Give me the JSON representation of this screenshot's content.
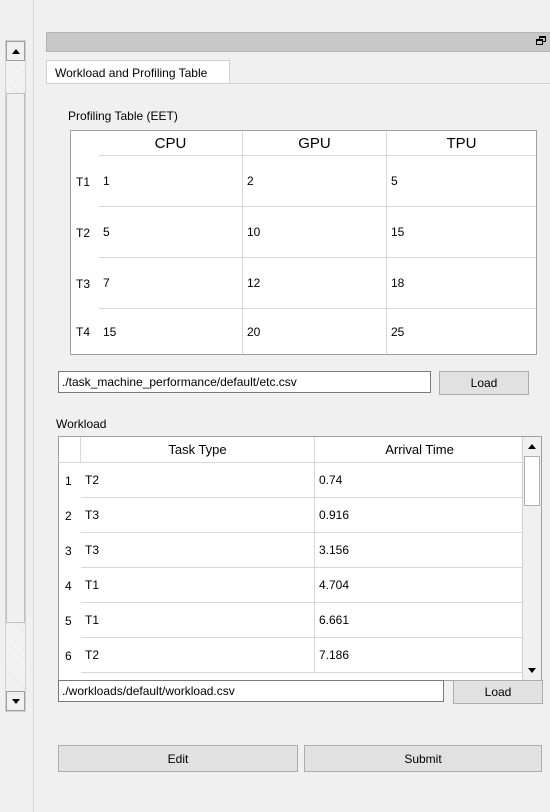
{
  "tab": {
    "label": "Workload and Profiling Table"
  },
  "profiling": {
    "section_label": "Profiling Table (EET)",
    "columns": [
      "CPU",
      "GPU",
      "TPU"
    ],
    "rows": [
      {
        "label": "T1",
        "values": [
          "1",
          "2",
          "5"
        ]
      },
      {
        "label": "T2",
        "values": [
          "5",
          "10",
          "15"
        ]
      },
      {
        "label": "T3",
        "values": [
          "7",
          "12",
          "18"
        ]
      },
      {
        "label": "T4",
        "values": [
          "15",
          "20",
          "25"
        ]
      }
    ],
    "path_value": "./task_machine_performance/default/etc.csv",
    "load_label": "Load"
  },
  "workload": {
    "section_label": "Workload",
    "columns": [
      "Task Type",
      "Arrival Time"
    ],
    "rows": [
      {
        "num": "1",
        "task_type": "T2",
        "arrival": "0.74"
      },
      {
        "num": "2",
        "task_type": "T3",
        "arrival": "0.916"
      },
      {
        "num": "3",
        "task_type": "T3",
        "arrival": "3.156"
      },
      {
        "num": "4",
        "task_type": "T1",
        "arrival": "4.704"
      },
      {
        "num": "5",
        "task_type": "T1",
        "arrival": "6.661"
      },
      {
        "num": "6",
        "task_type": "T2",
        "arrival": "7.186"
      }
    ],
    "path_value": "./workloads/default/workload.csv",
    "load_label": "Load"
  },
  "actions": {
    "edit_label": "Edit",
    "submit_label": "Submit"
  },
  "icons": {
    "scroll_up": "arrow-up-icon",
    "scroll_down": "arrow-down-icon",
    "float": "float-window-icon"
  }
}
